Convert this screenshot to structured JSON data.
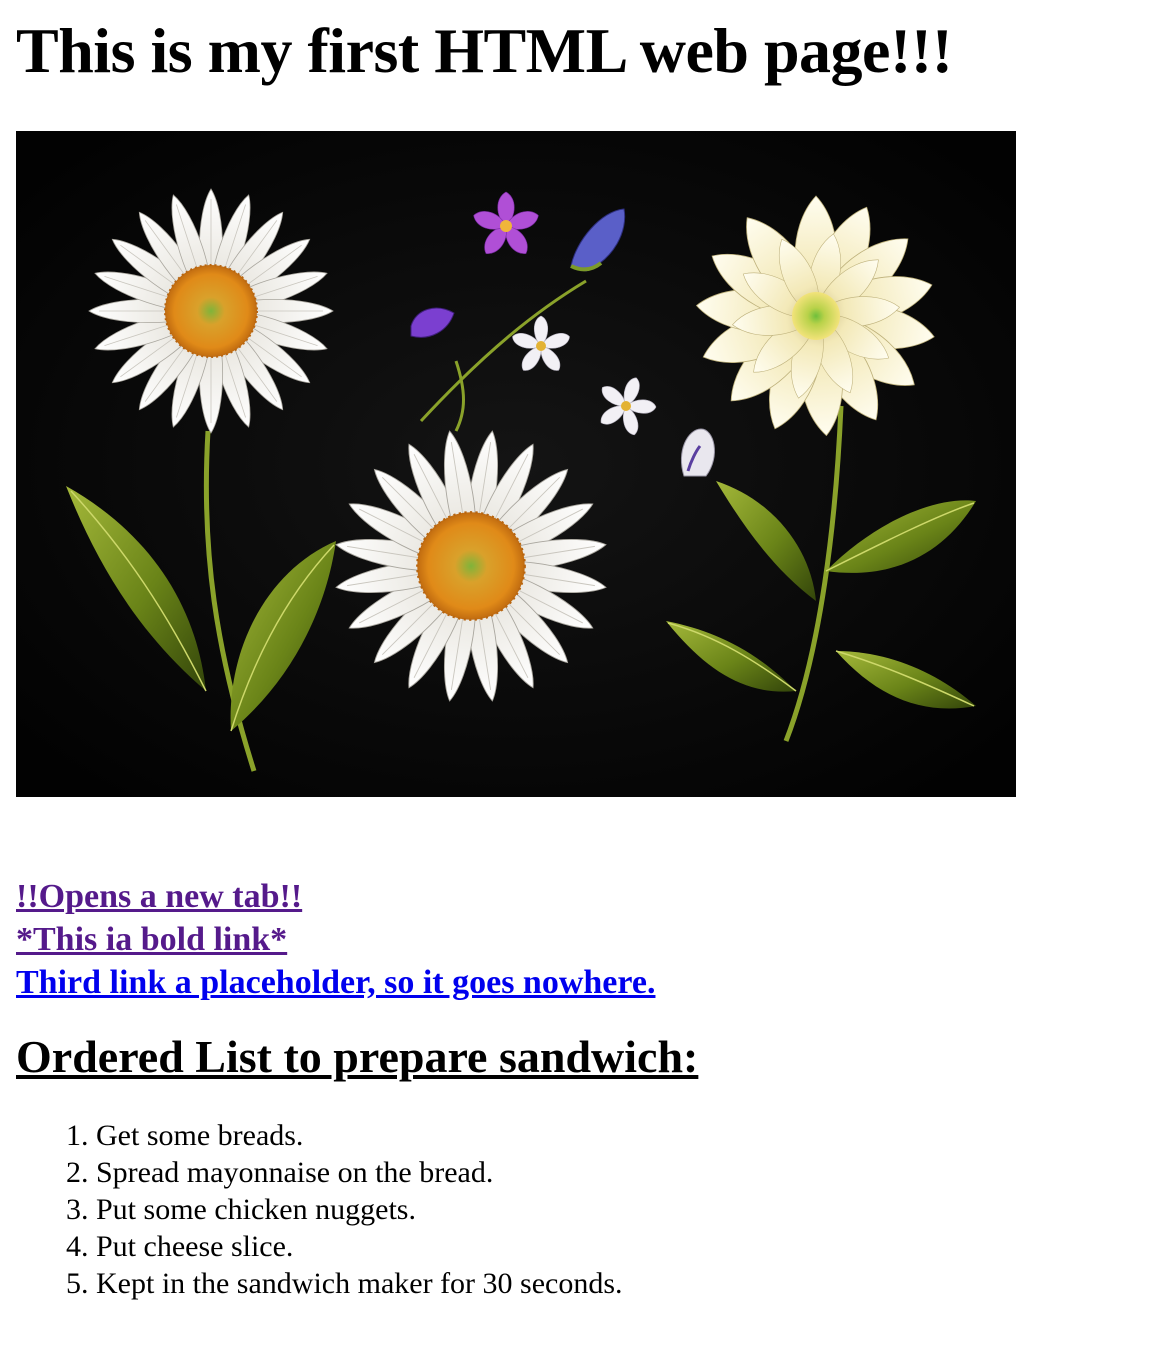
{
  "page": {
    "title": "This is my first HTML web page!!!"
  },
  "hero_image": {
    "description_icon": "flower-image",
    "colors": {
      "background": "#030303",
      "petal": "#f4f1ea",
      "center": "#e0921f",
      "leaf": "#6f8a1e",
      "violet": "#9b4fd0"
    }
  },
  "links": [
    {
      "label": "!!Opens a new tab!!",
      "color": "#551a8b"
    },
    {
      "label": "*This ia bold link*",
      "color": "#551a8b"
    },
    {
      "label": "Third link a placeholder, so it goes nowhere.",
      "color": "#0000ee"
    }
  ],
  "section": {
    "title": "Ordered List to prepare sandwich:"
  },
  "steps": [
    "Get some breads.",
    "Spread mayonnaise on the bread.",
    "Put some chicken nuggets.",
    "Put cheese slice.",
    "Kept in the sandwich maker for 30 seconds."
  ]
}
